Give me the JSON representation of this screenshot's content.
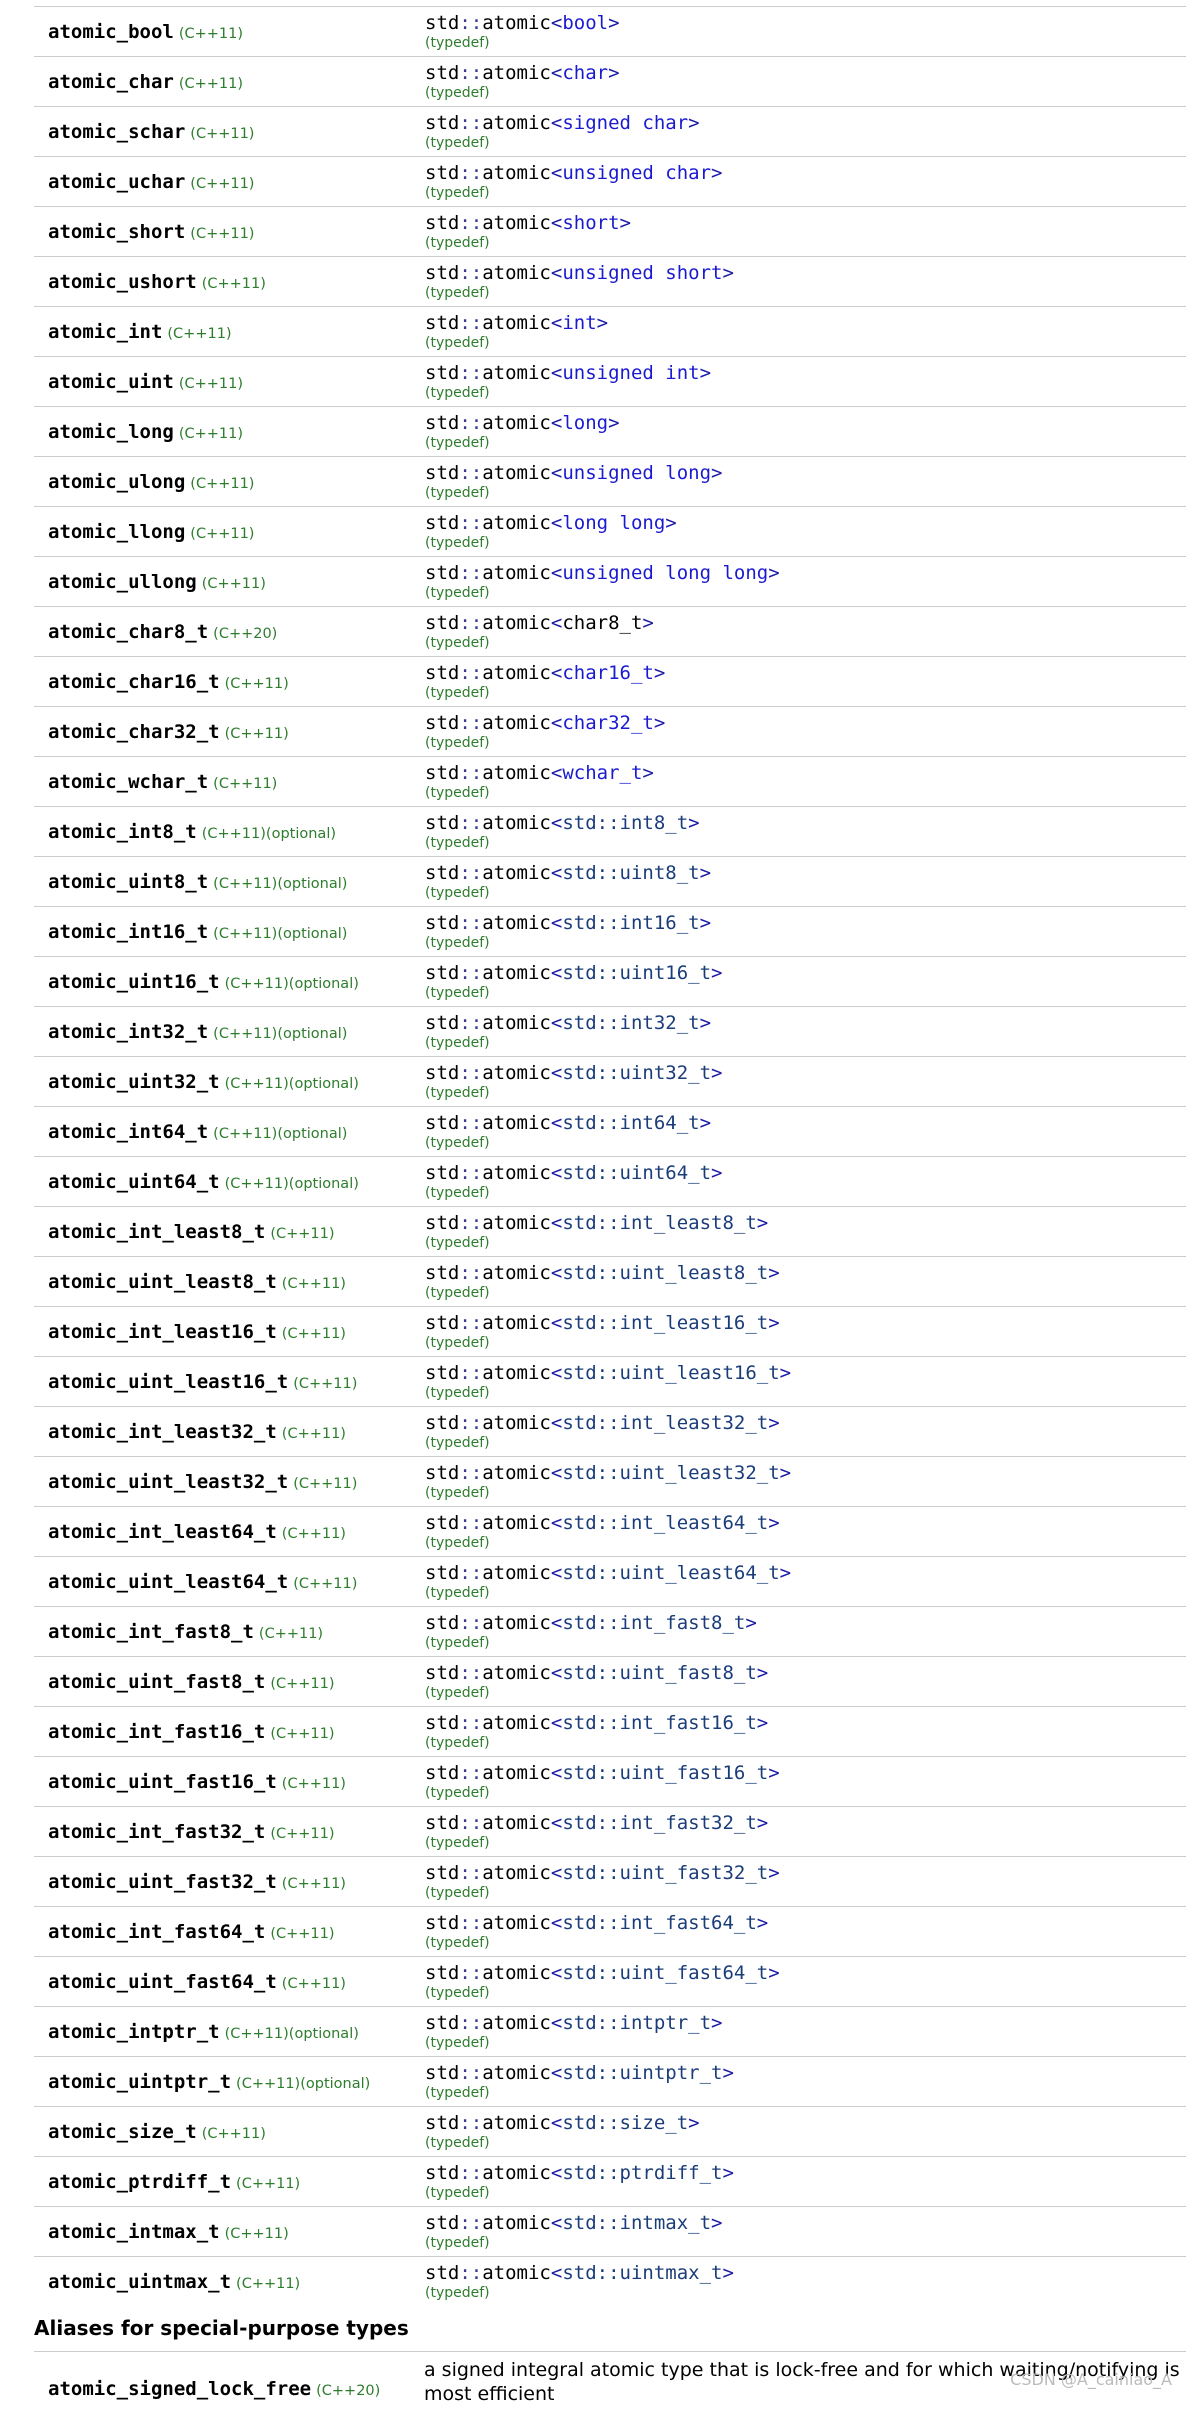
{
  "typedef_label": "(typedef)",
  "rows": [
    {
      "name": "atomic_bool",
      "rev": "(C++11)",
      "opt": "",
      "arg": "bool",
      "arg_style": "kw"
    },
    {
      "name": "atomic_char",
      "rev": "(C++11)",
      "opt": "",
      "arg": "char",
      "arg_style": "kw"
    },
    {
      "name": "atomic_schar",
      "rev": "(C++11)",
      "opt": "",
      "arg": "signed char",
      "arg_style": "kw"
    },
    {
      "name": "atomic_uchar",
      "rev": "(C++11)",
      "opt": "",
      "arg": "unsigned char",
      "arg_style": "kw"
    },
    {
      "name": "atomic_short",
      "rev": "(C++11)",
      "opt": "",
      "arg": "short",
      "arg_style": "kw"
    },
    {
      "name": "atomic_ushort",
      "rev": "(C++11)",
      "opt": "",
      "arg": "unsigned short",
      "arg_style": "kw"
    },
    {
      "name": "atomic_int",
      "rev": "(C++11)",
      "opt": "",
      "arg": "int",
      "arg_style": "kw"
    },
    {
      "name": "atomic_uint",
      "rev": "(C++11)",
      "opt": "",
      "arg": "unsigned int",
      "arg_style": "kw"
    },
    {
      "name": "atomic_long",
      "rev": "(C++11)",
      "opt": "",
      "arg": "long",
      "arg_style": "kw"
    },
    {
      "name": "atomic_ulong",
      "rev": "(C++11)",
      "opt": "",
      "arg": "unsigned long",
      "arg_style": "kw"
    },
    {
      "name": "atomic_llong",
      "rev": "(C++11)",
      "opt": "",
      "arg": "long long",
      "arg_style": "kw"
    },
    {
      "name": "atomic_ullong",
      "rev": "(C++11)",
      "opt": "",
      "arg": "unsigned long long",
      "arg_style": "kw"
    },
    {
      "name": "atomic_char8_t",
      "rev": "(C++20)",
      "opt": "",
      "arg": "char8_t",
      "arg_style": "plain"
    },
    {
      "name": "atomic_char16_t",
      "rev": "(C++11)",
      "opt": "",
      "arg": "char16_t",
      "arg_style": "kw"
    },
    {
      "name": "atomic_char32_t",
      "rev": "(C++11)",
      "opt": "",
      "arg": "char32_t",
      "arg_style": "kw"
    },
    {
      "name": "atomic_wchar_t",
      "rev": "(C++11)",
      "opt": "",
      "arg": "wchar_t",
      "arg_style": "kw"
    },
    {
      "name": "atomic_int8_t",
      "rev": "(C++11)",
      "opt": "(optional)",
      "arg": "std::int8_t",
      "arg_style": "std"
    },
    {
      "name": "atomic_uint8_t",
      "rev": "(C++11)",
      "opt": "(optional)",
      "arg": "std::uint8_t",
      "arg_style": "std"
    },
    {
      "name": "atomic_int16_t",
      "rev": "(C++11)",
      "opt": "(optional)",
      "arg": "std::int16_t",
      "arg_style": "std"
    },
    {
      "name": "atomic_uint16_t",
      "rev": "(C++11)",
      "opt": "(optional)",
      "arg": "std::uint16_t",
      "arg_style": "std"
    },
    {
      "name": "atomic_int32_t",
      "rev": "(C++11)",
      "opt": "(optional)",
      "arg": "std::int32_t",
      "arg_style": "std"
    },
    {
      "name": "atomic_uint32_t",
      "rev": "(C++11)",
      "opt": "(optional)",
      "arg": "std::uint32_t",
      "arg_style": "std"
    },
    {
      "name": "atomic_int64_t",
      "rev": "(C++11)",
      "opt": "(optional)",
      "arg": "std::int64_t",
      "arg_style": "std"
    },
    {
      "name": "atomic_uint64_t",
      "rev": "(C++11)",
      "opt": "(optional)",
      "arg": "std::uint64_t",
      "arg_style": "std"
    },
    {
      "name": "atomic_int_least8_t",
      "rev": "(C++11)",
      "opt": "",
      "arg": "std::int_least8_t",
      "arg_style": "std"
    },
    {
      "name": "atomic_uint_least8_t",
      "rev": "(C++11)",
      "opt": "",
      "arg": "std::uint_least8_t",
      "arg_style": "std"
    },
    {
      "name": "atomic_int_least16_t",
      "rev": "(C++11)",
      "opt": "",
      "arg": "std::int_least16_t",
      "arg_style": "std"
    },
    {
      "name": "atomic_uint_least16_t",
      "rev": "(C++11)",
      "opt": "",
      "arg": "std::uint_least16_t",
      "arg_style": "std"
    },
    {
      "name": "atomic_int_least32_t",
      "rev": "(C++11)",
      "opt": "",
      "arg": "std::int_least32_t",
      "arg_style": "std"
    },
    {
      "name": "atomic_uint_least32_t",
      "rev": "(C++11)",
      "opt": "",
      "arg": "std::uint_least32_t",
      "arg_style": "std"
    },
    {
      "name": "atomic_int_least64_t",
      "rev": "(C++11)",
      "opt": "",
      "arg": "std::int_least64_t",
      "arg_style": "std"
    },
    {
      "name": "atomic_uint_least64_t",
      "rev": "(C++11)",
      "opt": "",
      "arg": "std::uint_least64_t",
      "arg_style": "std"
    },
    {
      "name": "atomic_int_fast8_t",
      "rev": "(C++11)",
      "opt": "",
      "arg": "std::int_fast8_t",
      "arg_style": "std"
    },
    {
      "name": "atomic_uint_fast8_t",
      "rev": "(C++11)",
      "opt": "",
      "arg": "std::uint_fast8_t",
      "arg_style": "std"
    },
    {
      "name": "atomic_int_fast16_t",
      "rev": "(C++11)",
      "opt": "",
      "arg": "std::int_fast16_t",
      "arg_style": "std"
    },
    {
      "name": "atomic_uint_fast16_t",
      "rev": "(C++11)",
      "opt": "",
      "arg": "std::uint_fast16_t",
      "arg_style": "std"
    },
    {
      "name": "atomic_int_fast32_t",
      "rev": "(C++11)",
      "opt": "",
      "arg": "std::int_fast32_t",
      "arg_style": "std"
    },
    {
      "name": "atomic_uint_fast32_t",
      "rev": "(C++11)",
      "opt": "",
      "arg": "std::uint_fast32_t",
      "arg_style": "std"
    },
    {
      "name": "atomic_int_fast64_t",
      "rev": "(C++11)",
      "opt": "",
      "arg": "std::int_fast64_t",
      "arg_style": "std"
    },
    {
      "name": "atomic_uint_fast64_t",
      "rev": "(C++11)",
      "opt": "",
      "arg": "std::uint_fast64_t",
      "arg_style": "std"
    },
    {
      "name": "atomic_intptr_t",
      "rev": "(C++11)",
      "opt": "(optional)",
      "arg": "std::intptr_t",
      "arg_style": "std"
    },
    {
      "name": "atomic_uintptr_t",
      "rev": "(C++11)",
      "opt": "(optional)",
      "arg": "std::uintptr_t",
      "arg_style": "std"
    },
    {
      "name": "atomic_size_t",
      "rev": "(C++11)",
      "opt": "",
      "arg": "std::size_t",
      "arg_style": "std"
    },
    {
      "name": "atomic_ptrdiff_t",
      "rev": "(C++11)",
      "opt": "",
      "arg": "std::ptrdiff_t",
      "arg_style": "std"
    },
    {
      "name": "atomic_intmax_t",
      "rev": "(C++11)",
      "opt": "",
      "arg": "std::intmax_t",
      "arg_style": "std"
    },
    {
      "name": "atomic_uintmax_t",
      "rev": "(C++11)",
      "opt": "",
      "arg": "std::uintmax_t",
      "arg_style": "std"
    }
  ],
  "decl": {
    "ns": "std",
    "sep": "::",
    "tmpl": "atomic",
    "open": "<",
    "close": ">"
  },
  "section_heading": "Aliases for special-purpose types",
  "special": {
    "name": "atomic_signed_lock_free",
    "rev": "(C++20)",
    "desc": "a signed integral atomic type that is lock-free and for which waiting/notifying is most efficient"
  },
  "watermark": "CSDN @A_cainiao_A"
}
